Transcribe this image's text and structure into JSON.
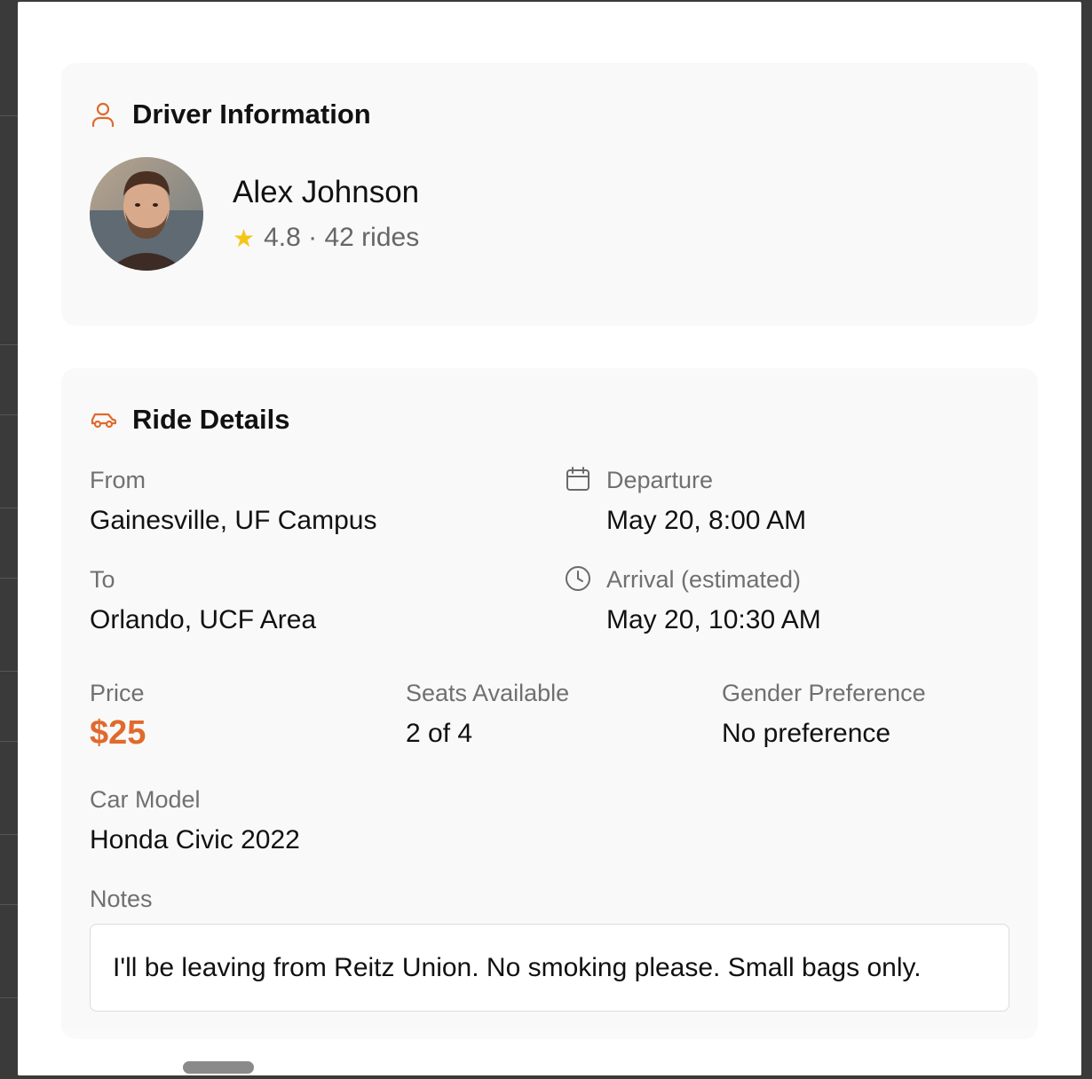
{
  "driver_section": {
    "title": "Driver Information",
    "icon": "user-icon",
    "name": "Alex Johnson",
    "star": "★",
    "rating_text": "4.8 · 42 rides"
  },
  "ride_section": {
    "title": "Ride Details",
    "icon": "car-icon",
    "from_label": "From",
    "from_value": "Gainesville, UF Campus",
    "to_label": "To",
    "to_value": "Orlando, UCF Area",
    "departure_label": "Departure",
    "departure_value": "May 20, 8:00 AM",
    "arrival_label": "Arrival (estimated)",
    "arrival_value": "May 20, 10:30 AM",
    "price_label": "Price",
    "price_value": "$25",
    "seats_label": "Seats Available",
    "seats_value": "2 of 4",
    "gender_label": "Gender Preference",
    "gender_value": "No preference",
    "car_label": "Car Model",
    "car_value": "Honda Civic 2022",
    "notes_label": "Notes",
    "notes_value": "I'll be leaving from Reitz Union. No smoking please. Small bags only."
  },
  "colors": {
    "accent": "#e06a2c",
    "star": "#f5c518",
    "card_bg": "#f9f9f9"
  }
}
